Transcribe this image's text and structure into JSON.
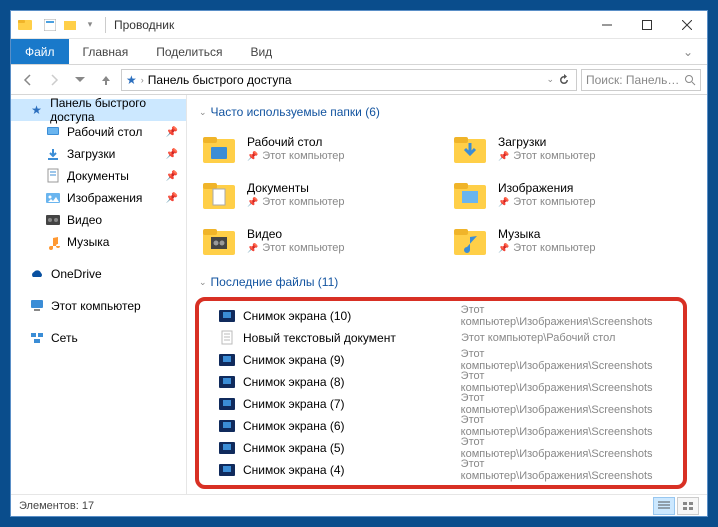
{
  "window": {
    "title": "Проводник"
  },
  "ribbon": {
    "file": "Файл",
    "tabs": [
      "Главная",
      "Поделиться",
      "Вид"
    ]
  },
  "address": {
    "path": "Панель быстрого доступа"
  },
  "search": {
    "placeholder": "Поиск: Панель б..."
  },
  "sidebar": {
    "quick_access": "Панель быстрого доступа",
    "items": [
      {
        "label": "Рабочий стол",
        "pinned": true,
        "icon": "desktop"
      },
      {
        "label": "Загрузки",
        "pinned": true,
        "icon": "downloads"
      },
      {
        "label": "Документы",
        "pinned": true,
        "icon": "documents"
      },
      {
        "label": "Изображения",
        "pinned": true,
        "icon": "pictures"
      },
      {
        "label": "Видео",
        "pinned": false,
        "icon": "videos"
      },
      {
        "label": "Музыка",
        "pinned": false,
        "icon": "music"
      }
    ],
    "onedrive": "OneDrive",
    "thispc": "Этот компьютер",
    "network": "Сеть"
  },
  "sections": {
    "frequent": {
      "title": "Часто используемые папки (6)"
    },
    "recent": {
      "title": "Последние файлы (11)"
    }
  },
  "folders": [
    {
      "name": "Рабочий стол",
      "sub": "Этот компьютер",
      "icon": "desktop-folder"
    },
    {
      "name": "Загрузки",
      "sub": "Этот компьютер",
      "icon": "downloads-folder"
    },
    {
      "name": "Документы",
      "sub": "Этот компьютер",
      "icon": "documents-folder"
    },
    {
      "name": "Изображения",
      "sub": "Этот компьютер",
      "icon": "pictures-folder"
    },
    {
      "name": "Видео",
      "sub": "Этот компьютер",
      "icon": "videos-folder"
    },
    {
      "name": "Музыка",
      "sub": "Этот компьютер",
      "icon": "music-folder"
    }
  ],
  "recent_files": [
    {
      "name": "Снимок экрана (10)",
      "path": "Этот компьютер\\Изображения\\Screenshots",
      "icon": "image"
    },
    {
      "name": "Новый текстовый документ",
      "path": "Этот компьютер\\Рабочий стол",
      "icon": "text"
    },
    {
      "name": "Снимок экрана (9)",
      "path": "Этот компьютер\\Изображения\\Screenshots",
      "icon": "image"
    },
    {
      "name": "Снимок экрана (8)",
      "path": "Этот компьютер\\Изображения\\Screenshots",
      "icon": "image"
    },
    {
      "name": "Снимок экрана (7)",
      "path": "Этот компьютер\\Изображения\\Screenshots",
      "icon": "image"
    },
    {
      "name": "Снимок экрана (6)",
      "path": "Этот компьютер\\Изображения\\Screenshots",
      "icon": "image"
    },
    {
      "name": "Снимок экрана (5)",
      "path": "Этот компьютер\\Изображения\\Screenshots",
      "icon": "image"
    },
    {
      "name": "Снимок экрана (4)",
      "path": "Этот компьютер\\Изображения\\Screenshots",
      "icon": "image"
    }
  ],
  "statusbar": {
    "count": "Элементов: 17"
  }
}
